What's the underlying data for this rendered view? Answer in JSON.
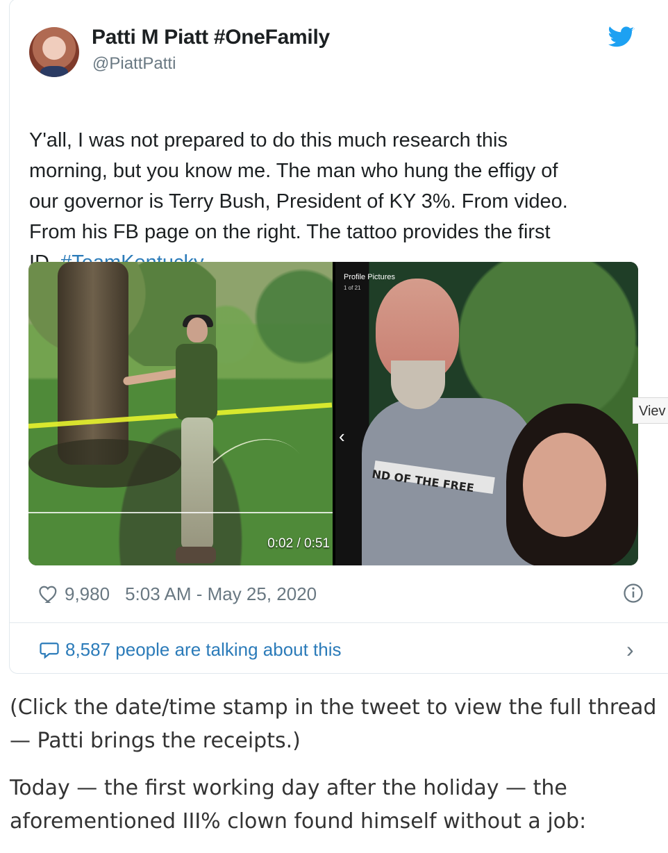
{
  "tweet": {
    "author_name": "Patti M Piatt #OneFamily",
    "author_handle": "@PiattPatti",
    "text_main": "Y'all, I was not prepared to do this much research this\nmorning, but you know me. The man who hung the effigy of\nour governor is Terry Bush, President of KY 3%. From video.\nFrom his FB page on the right. The tattoo provides the first\nID. ",
    "hashtag": "#TeamKentucky",
    "video_time": "0:02 / 0:51",
    "profile_label": "Profile Pictures",
    "profile_count": "1 of 21",
    "shirt_text": "ND OF THE FREE",
    "like_count": "9,980",
    "timestamp": "5:03 AM - May 25, 2020",
    "talking_text": "8,587 people are talking about this",
    "view_tab": "Viev",
    "icons": {
      "twitter": "twitter-bird-icon",
      "heart": "heart-icon",
      "info": "info-icon",
      "chat": "chat-bubble-icon",
      "chevron": "chevron-right-icon"
    },
    "colors": {
      "accent": "#2b7bb9",
      "twitter": "#1da1f2",
      "muted": "#697882"
    }
  },
  "article": {
    "paragraph1": "(Click the date/time stamp in the tweet to view the full thread\n— Patti brings the receipts.)",
    "paragraph2": "Today — the first working day after the holiday — the\naforementioned III% clown found himself without a job:"
  }
}
